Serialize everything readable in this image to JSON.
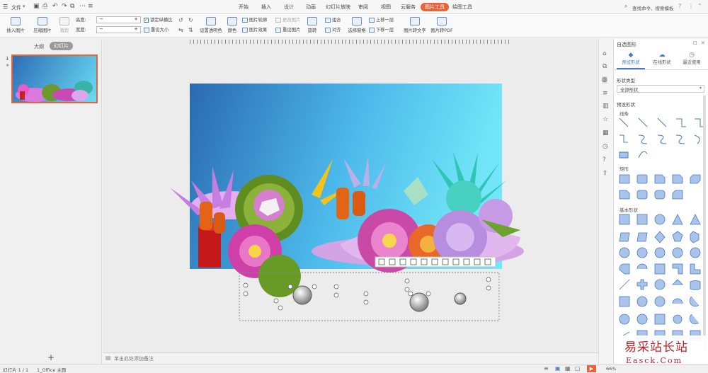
{
  "app": {
    "file_menu": "文件",
    "tabs": [
      "开始",
      "插入",
      "设计",
      "动画",
      "幻灯片放映",
      "审阅",
      "视图",
      "云服务",
      "图片工具",
      "绘图工具"
    ],
    "active_tab": "图片工具",
    "search_placeholder": "查找命令、搜索模板"
  },
  "toolbar": {
    "insert_picture": "插入图片",
    "compress_picture": "压缩图片",
    "crop": "裁剪",
    "height_label": "高度:",
    "width_label": "宽度:",
    "lock_ratio": "锁定纵横比",
    "reset_size": "重设大小",
    "set_transparent": "设置透明色",
    "color": "颜色",
    "picture_outline": "图片轮廓",
    "picture_effects": "图片效果",
    "change_picture": "更改图片",
    "reset_picture": "重设图片",
    "combine": "组合",
    "rotate": "旋转",
    "align": "对齐",
    "selection_pane": "选择窗格",
    "bring_forward": "上移一层",
    "send_backward": "下移一层",
    "picture_to_text": "图片转文字",
    "picture_to_pdf": "图片转PDF"
  },
  "left_panel": {
    "tab_outline": "大纲",
    "tab_slides": "幻灯片",
    "slide_number": "1",
    "add_symbol": "+"
  },
  "notes": {
    "placeholder": "单击此处添加备注"
  },
  "right_panel": {
    "title": "自选图形",
    "tabs": [
      "预设形状",
      "在线形状",
      "最近使用"
    ],
    "shape_type_label": "形状类型",
    "shape_type_value": "全部形状",
    "preset_label": "预设形状",
    "sections": [
      "线条",
      "矩形",
      "基本形状"
    ]
  },
  "status": {
    "slide_info": "幻灯片 1 / 1",
    "theme": "1_Office 主题",
    "zoom": "66%"
  },
  "watermark": {
    "cn": "易采站长站",
    "en": "Easck.Com"
  },
  "colors": {
    "accent": "#e8623a",
    "toolbar_blue": "#4a78c2"
  }
}
